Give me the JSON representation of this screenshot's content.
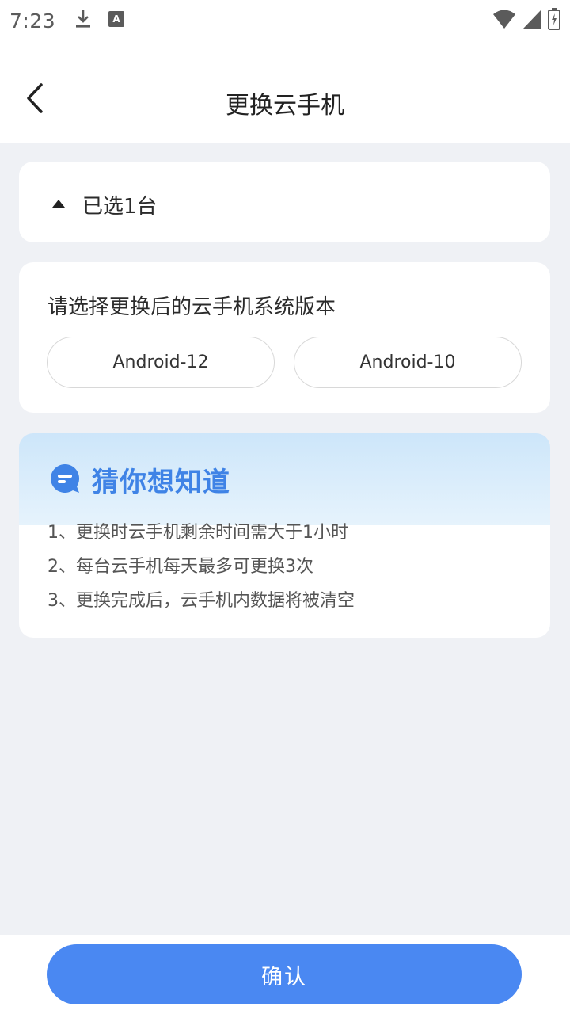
{
  "status_bar": {
    "time": "7:23",
    "icons_left": [
      "download-icon",
      "keyboard-a-icon"
    ],
    "icons_right": [
      "wifi-icon",
      "signal-icon",
      "battery-icon"
    ]
  },
  "header": {
    "title": "更换云手机",
    "back_icon": "chevron-left-icon"
  },
  "selected": {
    "label": "已选1台",
    "toggle_icon": "caret-up-icon"
  },
  "version": {
    "prompt": "请选择更换后的云手机系统版本",
    "options": [
      "Android-12",
      "Android-10"
    ]
  },
  "tips": {
    "title": "猜你想知道",
    "icon": "chat-bubble-icon",
    "items": [
      "1、更换时云手机剩余时间需大于1小时",
      "2、每台云手机每天最多可更换3次",
      "3、更换完成后，云手机内数据将被清空"
    ]
  },
  "footer": {
    "confirm_label": "确认"
  },
  "colors": {
    "accent": "#4a88f2",
    "tips_title": "#3f83e6",
    "background": "#eff1f5"
  }
}
